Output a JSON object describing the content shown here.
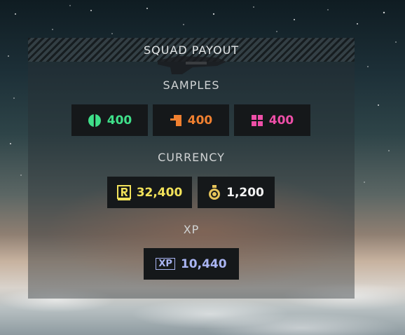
{
  "panel": {
    "title": "SQUAD PAYOUT"
  },
  "samples": {
    "title": "SAMPLES",
    "items": [
      {
        "icon": "common-sample-icon",
        "value": "400",
        "color": "#3fe08a"
      },
      {
        "icon": "rare-sample-icon",
        "value": "400",
        "color": "#f08030"
      },
      {
        "icon": "super-sample-icon",
        "value": "400",
        "color": "#ee4fa8"
      }
    ]
  },
  "currency": {
    "title": "CURRENCY",
    "items": [
      {
        "icon": "requisition-icon",
        "value": "32,400",
        "color": "#f2e25a"
      },
      {
        "icon": "medal-icon",
        "value": "1,200",
        "color": "#f2f2f2"
      }
    ]
  },
  "xp": {
    "title": "XP",
    "item": {
      "icon": "xp-icon",
      "badge": "XP",
      "value": "10,440",
      "color": "#a9b4f2"
    }
  }
}
